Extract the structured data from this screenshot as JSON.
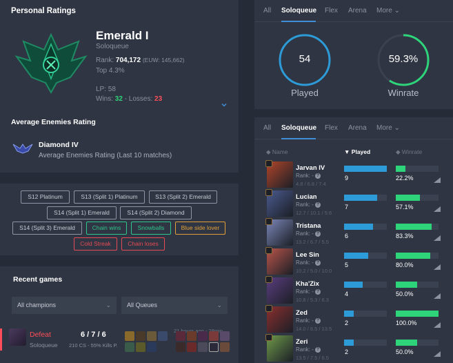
{
  "personal": {
    "title": "Personal Ratings",
    "tier": "Emerald I",
    "queue": "Soloqueue",
    "rank_label": "Rank: ",
    "rank_value": "704,172",
    "rank_region": "(EUW: 145,662)",
    "top": "Top 4.3%",
    "lp": "LP: 58",
    "wins_label": "Wins: ",
    "wins": "32",
    "losses_label": " - Losses: ",
    "losses": "23"
  },
  "avg_enemies": {
    "title": "Average Enemies Rating",
    "tier": "Diamond IV",
    "desc": "Average Enemies Rating (Last 10 matches)"
  },
  "tags": [
    {
      "label": "S12 Platinum",
      "color": "gray"
    },
    {
      "label": "S13 (Split 1) Platinum",
      "color": "gray"
    },
    {
      "label": "S13 (Split 2) Emerald",
      "color": "gray"
    },
    {
      "label": "S14 (Split 1) Emerald",
      "color": "gray"
    },
    {
      "label": "S14 (Split 2) Diamond",
      "color": "gray"
    },
    {
      "label": "S14 (Split 3) Emerald",
      "color": "gray"
    },
    {
      "label": "Chain wins",
      "color": "green"
    },
    {
      "label": "Snowballs",
      "color": "green"
    },
    {
      "label": "Blue side lover",
      "color": "orange"
    },
    {
      "label": "Cold Streak",
      "color": "red"
    },
    {
      "label": "Chain loses",
      "color": "red"
    }
  ],
  "recent": {
    "title": "Recent games",
    "champ_filter": "All champions",
    "queue_filter": "All Queues",
    "game": {
      "result": "Defeat",
      "queue": "Soloqueue",
      "kda": "6 / 7 / 6",
      "cs": "210 CS - 55% Kills P.",
      "time": "21 hours ago - 28min"
    }
  },
  "queue_tabs": [
    "All",
    "Soloqueue",
    "Flex",
    "Arena",
    "More"
  ],
  "summary": {
    "played_value": "54",
    "played_label": "Played",
    "winrate_value": "59.3%",
    "winrate_label": "Winrate",
    "winrate_fraction": 0.593
  },
  "stats_table": {
    "col_name": "Name",
    "col_played": "Played",
    "col_winrate": "Winrate",
    "rows": [
      {
        "name": "Jarvan IV",
        "rank": "Rank: -",
        "kda": "4.8 / 6.8 / 7.4",
        "played": "9",
        "played_fraction": 1.0,
        "winrate": "22.2%",
        "winrate_fraction": 0.222,
        "color": "#b0452a"
      },
      {
        "name": "Lucian",
        "rank": "Rank: -",
        "kda": "12.7 / 10.1 / 5.6",
        "played": "7",
        "played_fraction": 0.78,
        "winrate": "57.1%",
        "winrate_fraction": 0.571,
        "color": "#4a5a8e"
      },
      {
        "name": "Tristana",
        "rank": "Rank: -",
        "kda": "13.2 / 6.7 / 5.5",
        "played": "6",
        "played_fraction": 0.67,
        "winrate": "83.3%",
        "winrate_fraction": 0.833,
        "color": "#7a86b8"
      },
      {
        "name": "Lee Sin",
        "rank": "Rank: -",
        "kda": "10.2 / 5.0 / 10.0",
        "played": "5",
        "played_fraction": 0.56,
        "winrate": "80.0%",
        "winrate_fraction": 0.8,
        "color": "#b8544a"
      },
      {
        "name": "Kha'Zix",
        "rank": "Rank: -",
        "kda": "10.8 / 5.3 / 6.3",
        "played": "4",
        "played_fraction": 0.44,
        "winrate": "50.0%",
        "winrate_fraction": 0.5,
        "color": "#5a3d7e"
      },
      {
        "name": "Zed",
        "rank": "Rank: -",
        "kda": "14.0 / 8.5 / 13.5",
        "played": "2",
        "played_fraction": 0.22,
        "winrate": "100.0%",
        "winrate_fraction": 1.0,
        "color": "#8a2f2f"
      },
      {
        "name": "Zeri",
        "rank": "Rank: -",
        "kda": "13.5 / 7.5 / 6.5",
        "played": "2",
        "played_fraction": 0.22,
        "winrate": "50.0%",
        "winrate_fraction": 0.5,
        "color": "#6e9a4a"
      }
    ]
  }
}
